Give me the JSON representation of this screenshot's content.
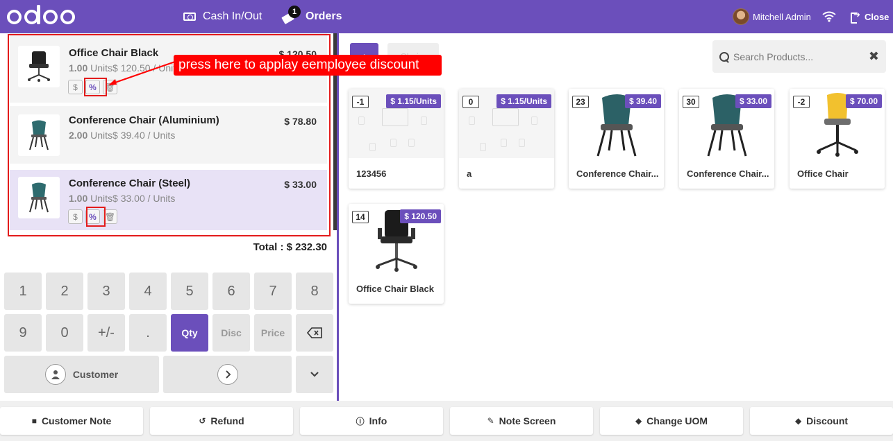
{
  "header": {
    "logo_text": "odoo",
    "cash_label": "Cash In/Out",
    "orders_label": "Orders",
    "orders_badge": "1",
    "user_name": "Mitchell Admin",
    "close_label": "Close"
  },
  "order": {
    "lines": [
      {
        "name": "Office Chair Black",
        "price": "$ 120.50",
        "qty": "1.00",
        "unit_text": "Units$ 120.50 / Units"
      },
      {
        "name": "Conference Chair (Aluminium)",
        "price": "$ 78.80",
        "qty": "2.00",
        "unit_text": "Units$ 39.40 / Units"
      },
      {
        "name": "Conference Chair (Steel)",
        "price": "$ 33.00",
        "qty": "1.00",
        "unit_text": "Units$ 33.00 / Units"
      }
    ],
    "action_dollar": "$",
    "action_percent": "%",
    "total": "Total : $ 232.30"
  },
  "numpad": {
    "keys": [
      "1",
      "2",
      "3",
      "4",
      "5",
      "6",
      "7",
      "8",
      "9",
      "0",
      "+/-",
      "."
    ],
    "qty": "Qty",
    "disc": "Disc",
    "price": "Price",
    "customer": "Customer"
  },
  "products_bar": {
    "home_label": "⌂",
    "category_label": "Chairs",
    "search_placeholder": "Search Products..."
  },
  "products": [
    {
      "qty": "-1",
      "price": "$ 1.15/Units",
      "name": "123456"
    },
    {
      "qty": "0",
      "price": "$ 1.15/Units",
      "name": "a"
    },
    {
      "qty": "23",
      "price": "$ 39.40",
      "name": "Conference Chair..."
    },
    {
      "qty": "30",
      "price": "$ 33.00",
      "name": "Conference Chair..."
    },
    {
      "qty": "-2",
      "price": "$ 70.00",
      "name": "Office Chair"
    },
    {
      "qty": "14",
      "price": "$ 120.50",
      "name": "Office Chair Black"
    }
  ],
  "control_buttons": {
    "customer_note": "Customer Note",
    "refund": "Refund",
    "info": "Info",
    "note_screen": "Note Screen",
    "change_uom": "Change UOM",
    "discount": "Discount"
  },
  "annotation": {
    "text": "press here to applay eemployee discount",
    "color": "#ff0000"
  },
  "colors": {
    "brand": "#6b4fbb",
    "annotation_box": "#e31b1b"
  }
}
